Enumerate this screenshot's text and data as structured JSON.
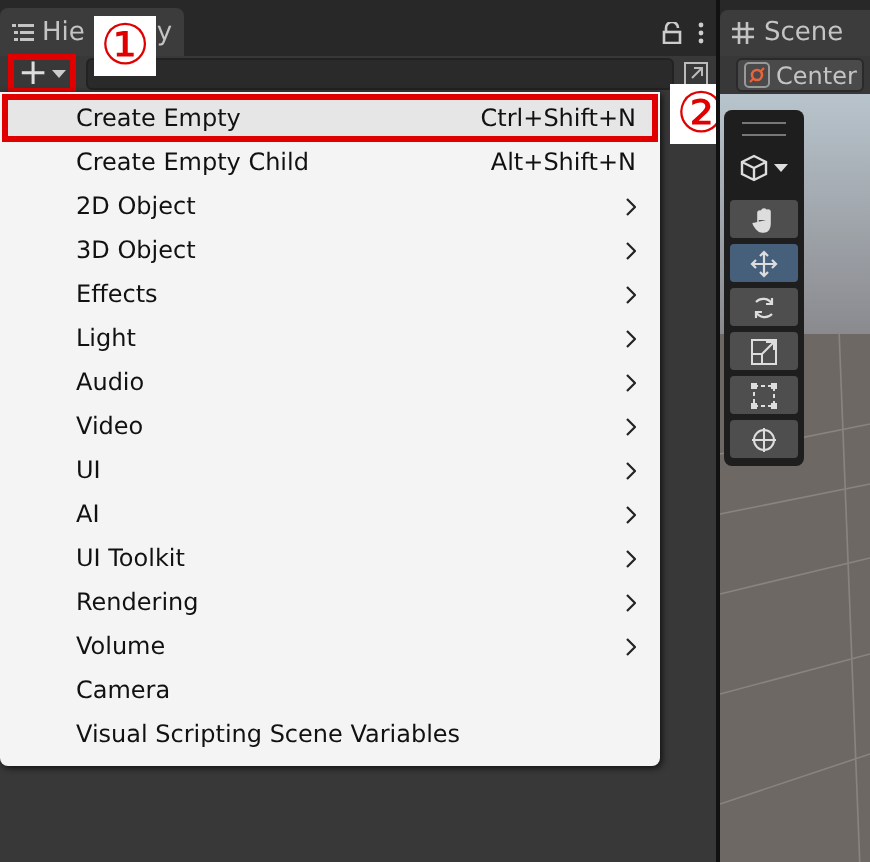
{
  "hierarchy": {
    "title_parts": [
      "Hie",
      "y"
    ],
    "add_button": "+"
  },
  "callouts": [
    {
      "label": "①"
    },
    {
      "label": "②"
    }
  ],
  "menu": [
    {
      "label": "Create Empty",
      "kind": "shortcut",
      "shortcut": "Ctrl+Shift+N",
      "selected": true
    },
    {
      "label": "Create Empty Child",
      "kind": "shortcut",
      "shortcut": "Alt+Shift+N",
      "selected": false
    },
    {
      "label": "2D Object",
      "kind": "submenu",
      "selected": false
    },
    {
      "label": "3D Object",
      "kind": "submenu",
      "selected": false
    },
    {
      "label": "Effects",
      "kind": "submenu",
      "selected": false
    },
    {
      "label": "Light",
      "kind": "submenu",
      "selected": false
    },
    {
      "label": "Audio",
      "kind": "submenu",
      "selected": false
    },
    {
      "label": "Video",
      "kind": "submenu",
      "selected": false
    },
    {
      "label": "UI",
      "kind": "submenu",
      "selected": false
    },
    {
      "label": "AI",
      "kind": "submenu",
      "selected": false
    },
    {
      "label": "UI Toolkit",
      "kind": "submenu",
      "selected": false
    },
    {
      "label": "Rendering",
      "kind": "submenu",
      "selected": false
    },
    {
      "label": "Volume",
      "kind": "submenu",
      "selected": false
    },
    {
      "label": "Camera",
      "kind": "plain",
      "selected": false
    },
    {
      "label": "Visual Scripting Scene Variables",
      "kind": "plain",
      "selected": false
    }
  ],
  "scene": {
    "title": "Scene",
    "pivot_button": "Center",
    "tools": [
      {
        "kind": "hand",
        "selected": false
      },
      {
        "kind": "move",
        "selected": true
      },
      {
        "kind": "rotate",
        "selected": false
      },
      {
        "kind": "scale",
        "selected": false
      },
      {
        "kind": "rect",
        "selected": false
      },
      {
        "kind": "transform",
        "selected": false
      }
    ]
  }
}
